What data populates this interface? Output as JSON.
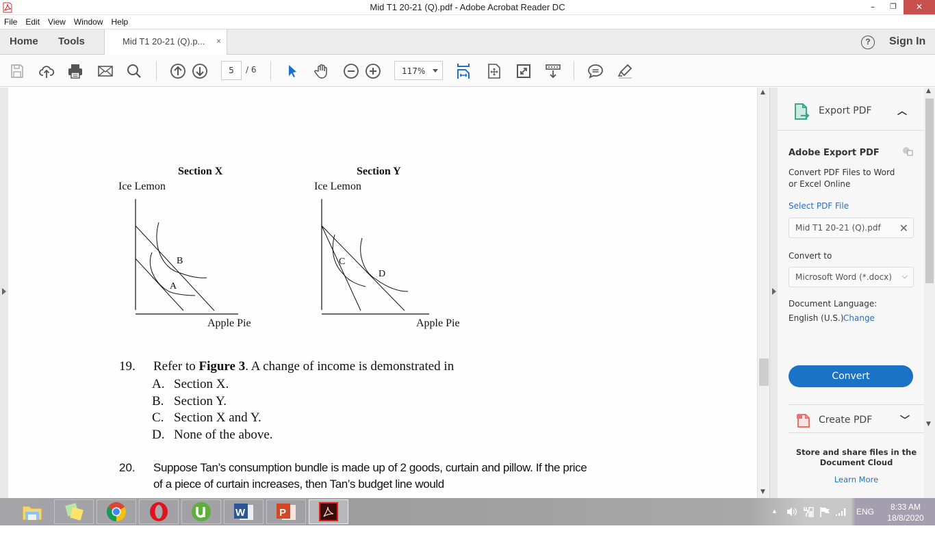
{
  "window": {
    "title": "Mid T1 20-21 (Q).pdf - Adobe Acrobat Reader DC",
    "minimize": "–",
    "restore": "❐",
    "close": "✕"
  },
  "menu": [
    "File",
    "Edit",
    "View",
    "Window",
    "Help"
  ],
  "tabs": {
    "home": "Home",
    "tools": "Tools",
    "document_tab": "Mid T1 20-21 (Q).p...",
    "close": "×",
    "help": "?",
    "sign_in": "Sign In"
  },
  "toolbar": {
    "icons": [
      "save-icon",
      "upload-icon",
      "print-icon",
      "email-icon",
      "search-icon",
      "page-up-icon",
      "page-down-icon",
      "select-cursor-icon",
      "hand-icon",
      "zoom-out-icon",
      "zoom-in-icon",
      "fit-width-icon",
      "fit-page-icon",
      "fullscreen-icon",
      "scroll-mode-icon",
      "comment-icon",
      "highlight-icon"
    ],
    "current_page": "5",
    "total_pages": "/ 6",
    "zoom": "117%"
  },
  "document": {
    "figures": [
      {
        "title": "Section X",
        "ylabel": "Ice Lemon",
        "xlabel": "Apple Pie",
        "points": [
          "A",
          "B"
        ]
      },
      {
        "title": "Section Y",
        "ylabel": "Ice Lemon",
        "xlabel": "Apple Pie",
        "points": [
          "C",
          "D"
        ]
      }
    ],
    "q19": {
      "number": "19.",
      "prefix": "Refer to ",
      "bold": "Figure 3",
      "suffix": ". A change of income is demonstrated in",
      "options": [
        {
          "letter": "A.",
          "text": "Section X."
        },
        {
          "letter": "B.",
          "text": "Section Y."
        },
        {
          "letter": "C.",
          "text": "Section X and Y."
        },
        {
          "letter": "D.",
          "text": "None of the above."
        }
      ]
    },
    "q20": {
      "number": "20.",
      "line1": "Suppose Tan’s consumption bundle is made up of 2 goods, curtain and pillow. If the price",
      "line2": "of a piece of curtain increases, then Tan’s budget line would"
    }
  },
  "right_panel": {
    "export_title": "Export PDF",
    "section_title": "Adobe Export PDF",
    "description": "Convert PDF Files to Word or Excel Online",
    "select_label": "Select PDF File",
    "selected_file": "Mid T1 20-21 (Q).pdf",
    "convert_to_label": "Convert to",
    "convert_to_value": "Microsoft Word (*.docx)",
    "language_label": "Document Language:",
    "language_value": "English (U.S.)",
    "change_link": "Change",
    "convert_button": "Convert",
    "create_pdf": "Create PDF",
    "cloud_text": "Store and share files in the Document Cloud",
    "learn_more": "Learn More",
    "colors": {
      "accent": "#1b73c8",
      "export_icon": "#3aa786",
      "create_icon": "#e8736a"
    }
  },
  "taskbar": {
    "apps": [
      "file-explorer",
      "sticky-notes",
      "chrome",
      "opera",
      "utorrent",
      "word",
      "powerpoint",
      "acrobat-reader"
    ],
    "lang": "ENG",
    "time": "8:33 AM",
    "date": "18/8/2020"
  }
}
